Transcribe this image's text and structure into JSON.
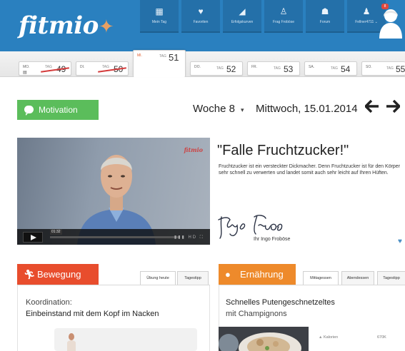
{
  "header": {
    "logo": "fitmio",
    "nav": [
      {
        "label": "Mein Tag",
        "icon": "calendar-icon",
        "glyph": "▦"
      },
      {
        "label": "Favoriten",
        "icon": "heart-icon",
        "glyph": "♥"
      },
      {
        "label": "Erfolgskurven",
        "icon": "chart-icon",
        "glyph": "◢"
      },
      {
        "label": "Frag Froböse",
        "icon": "person-question-icon",
        "glyph": "♙"
      },
      {
        "label": "Forum",
        "icon": "forum-icon",
        "glyph": "☗"
      },
      {
        "label": "Fellner4711 ⌄",
        "icon": "user-icon",
        "glyph": "♟"
      }
    ],
    "notification_count": "8"
  },
  "days": [
    {
      "abbr": "MO.",
      "tag": "TAG",
      "num": "49",
      "done": true
    },
    {
      "abbr": "DI.",
      "tag": "TAG",
      "num": "50",
      "done": true
    },
    {
      "abbr": "MI.",
      "tag": "TAG",
      "num": "51",
      "active": true
    },
    {
      "abbr": "DO.",
      "tag": "TAG",
      "num": "52"
    },
    {
      "abbr": "FR.",
      "tag": "TAG",
      "num": "53"
    },
    {
      "abbr": "SA.",
      "tag": "TAG",
      "num": "54"
    },
    {
      "abbr": "SO.",
      "tag": "TAG",
      "num": "55"
    }
  ],
  "motivation": {
    "label": "Motivation"
  },
  "week": {
    "label": "Woche 8",
    "caret": "▾"
  },
  "date": {
    "label": "Mittwoch, 15.01.2014"
  },
  "nav_arrows": {
    "prev": "🡐",
    "next": "🡒"
  },
  "video": {
    "brand": "fitmio",
    "time": "01:32",
    "controls": "▮▮▮ HD ⛶"
  },
  "quote": {
    "title": "\"Falle Fruchtzucker!\"",
    "text": "Fruchtzucker ist ein versteckter Dickmacher. Denn Fruchtzucker ist für den Körper sehr schnell zu verwerten und landet somit auch sehr leicht auf Ihren Hüften.",
    "signature_caption": "Ihr Ingo Froböse"
  },
  "bewegung": {
    "label": "Bewegung",
    "icon_glyph": "🏃",
    "tabs": [
      "Übung heute",
      "Tagestipp"
    ],
    "title_line1": "Koordination:",
    "title_line2": "Einbeinstand mit dem Kopf im Nacken"
  },
  "ernaehrung": {
    "label": "Ernährung",
    "icon_glyph": "🍎",
    "tabs": [
      "Mittagessen",
      "Abendessen",
      "Tagestipp"
    ],
    "title_line1": "Schnelles Putengeschnetzeltes",
    "title_line2": "mit Champignons",
    "nutrition_label": "Kalorien",
    "nutrition_value": "670K"
  },
  "colors": {
    "header": "#2a80bf",
    "motivation": "#5bbd5b",
    "bewegung": "#e84d2d",
    "ernaehrung": "#ee8a2b"
  }
}
